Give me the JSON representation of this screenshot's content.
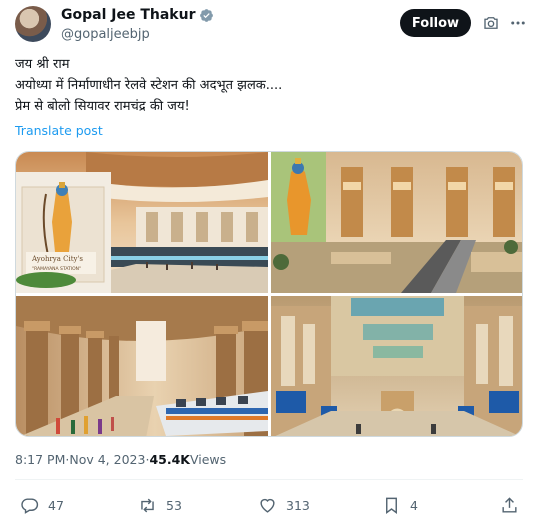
{
  "author": {
    "display_name": "Gopal Jee Thakur",
    "handle": "@gopaljeebjp",
    "verified": true
  },
  "header": {
    "follow_label": "Follow",
    "icons": [
      "camera-icon",
      "more-icon"
    ]
  },
  "tweet": {
    "lines": [
      "जय श्री राम",
      "अयोध्या में निर्माणाधीन रेलवे स्टेशन की अदभूत झलक....",
      "प्रेम से बोलो सियावर रामचंद्र की जय!"
    ],
    "translate_label": "Translate post"
  },
  "media": {
    "image_sign_text": "Ayohrya City's",
    "image_sign_subtext": "\"RAMAYANA STATION\""
  },
  "meta": {
    "time": "8:17 PM",
    "separator": " · ",
    "date": "Nov 4, 2023",
    "views_count": "45.4K",
    "views_label": " Views"
  },
  "actions": {
    "replies": "47",
    "reposts": "53",
    "likes": "313",
    "bookmarks": "4"
  },
  "colors": {
    "accent": "#1d9bf0",
    "text_primary": "#0f1419",
    "text_secondary": "#536471",
    "verified": "#829aab"
  }
}
